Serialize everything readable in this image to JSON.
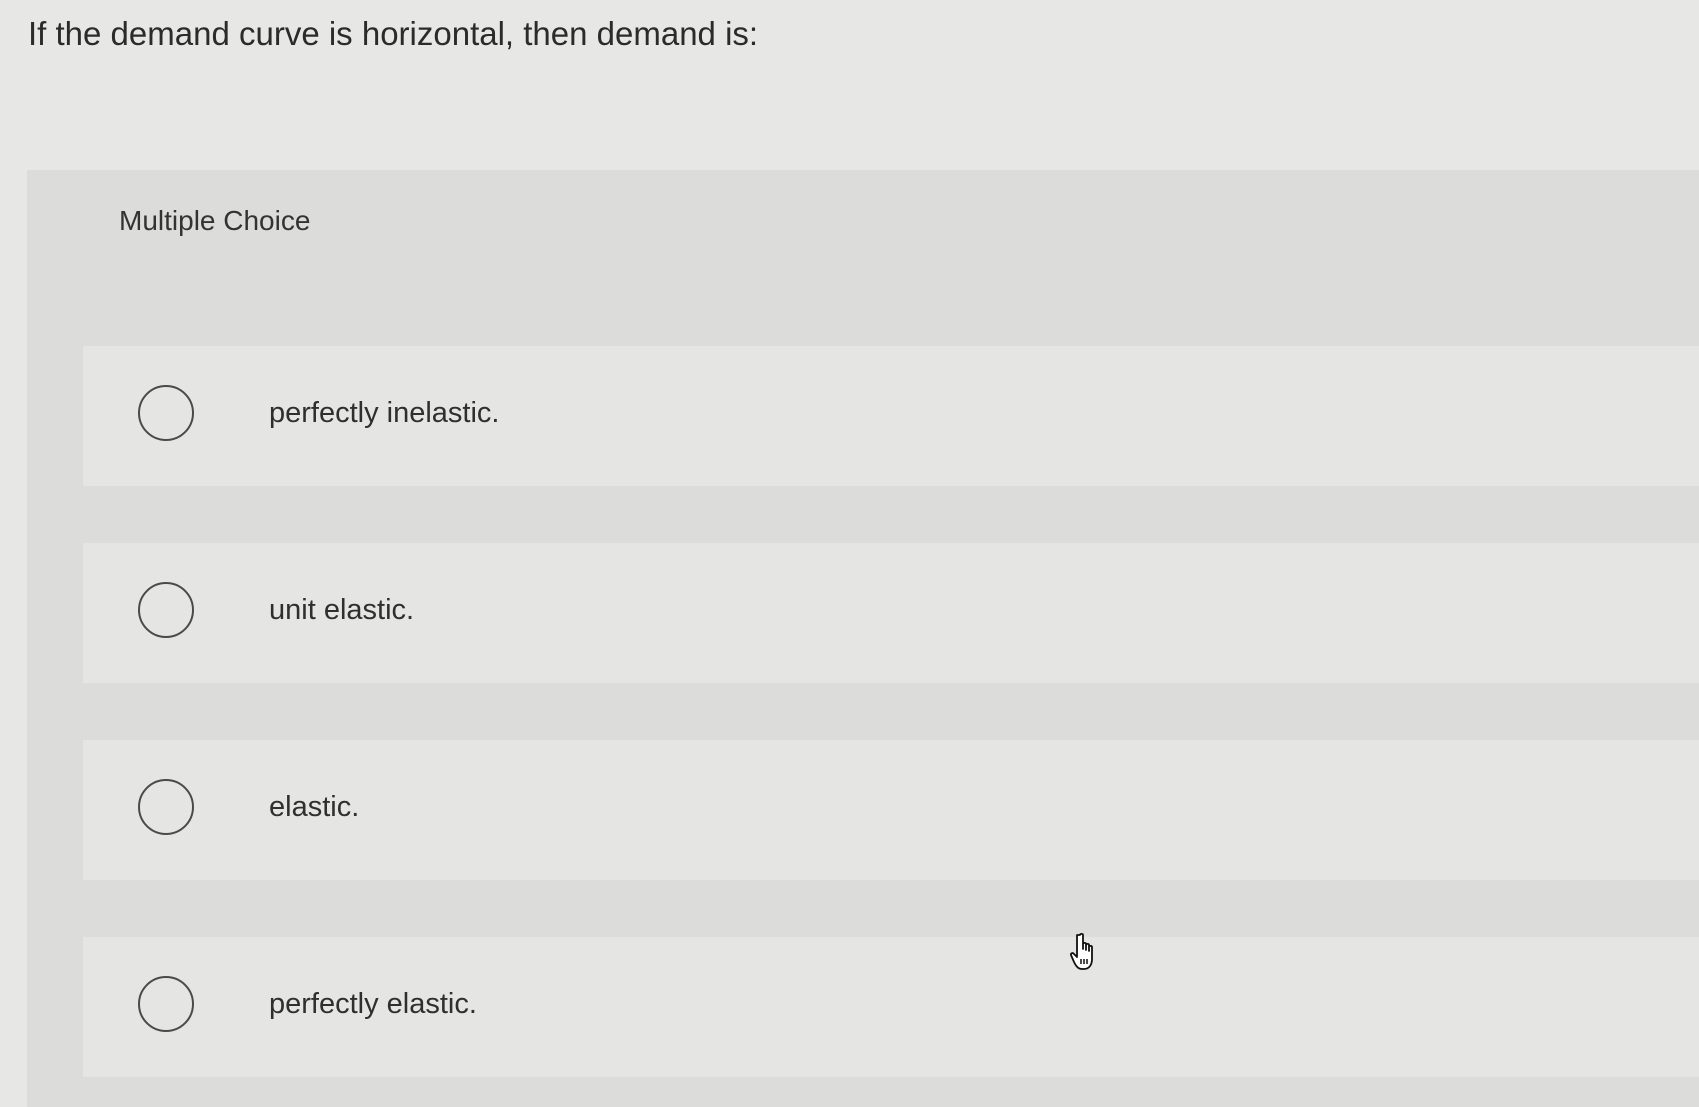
{
  "question": {
    "text": "If the demand curve is horizontal, then demand is:"
  },
  "panel": {
    "label": "Multiple Choice"
  },
  "options": [
    {
      "label": "perfectly inelastic.",
      "selected": false
    },
    {
      "label": "unit elastic.",
      "selected": false
    },
    {
      "label": "elastic.",
      "selected": false
    },
    {
      "label": "perfectly elastic.",
      "selected": false
    }
  ],
  "colors": {
    "background": "#e7e7e5",
    "panel": "#dcdcda",
    "option_row": "#e5e5e3",
    "radio_border": "#4a4a4a",
    "text": "#2f2f2f"
  },
  "icons": {
    "radio": "radio-circle-icon",
    "cursor": "hand-pointer-icon"
  }
}
